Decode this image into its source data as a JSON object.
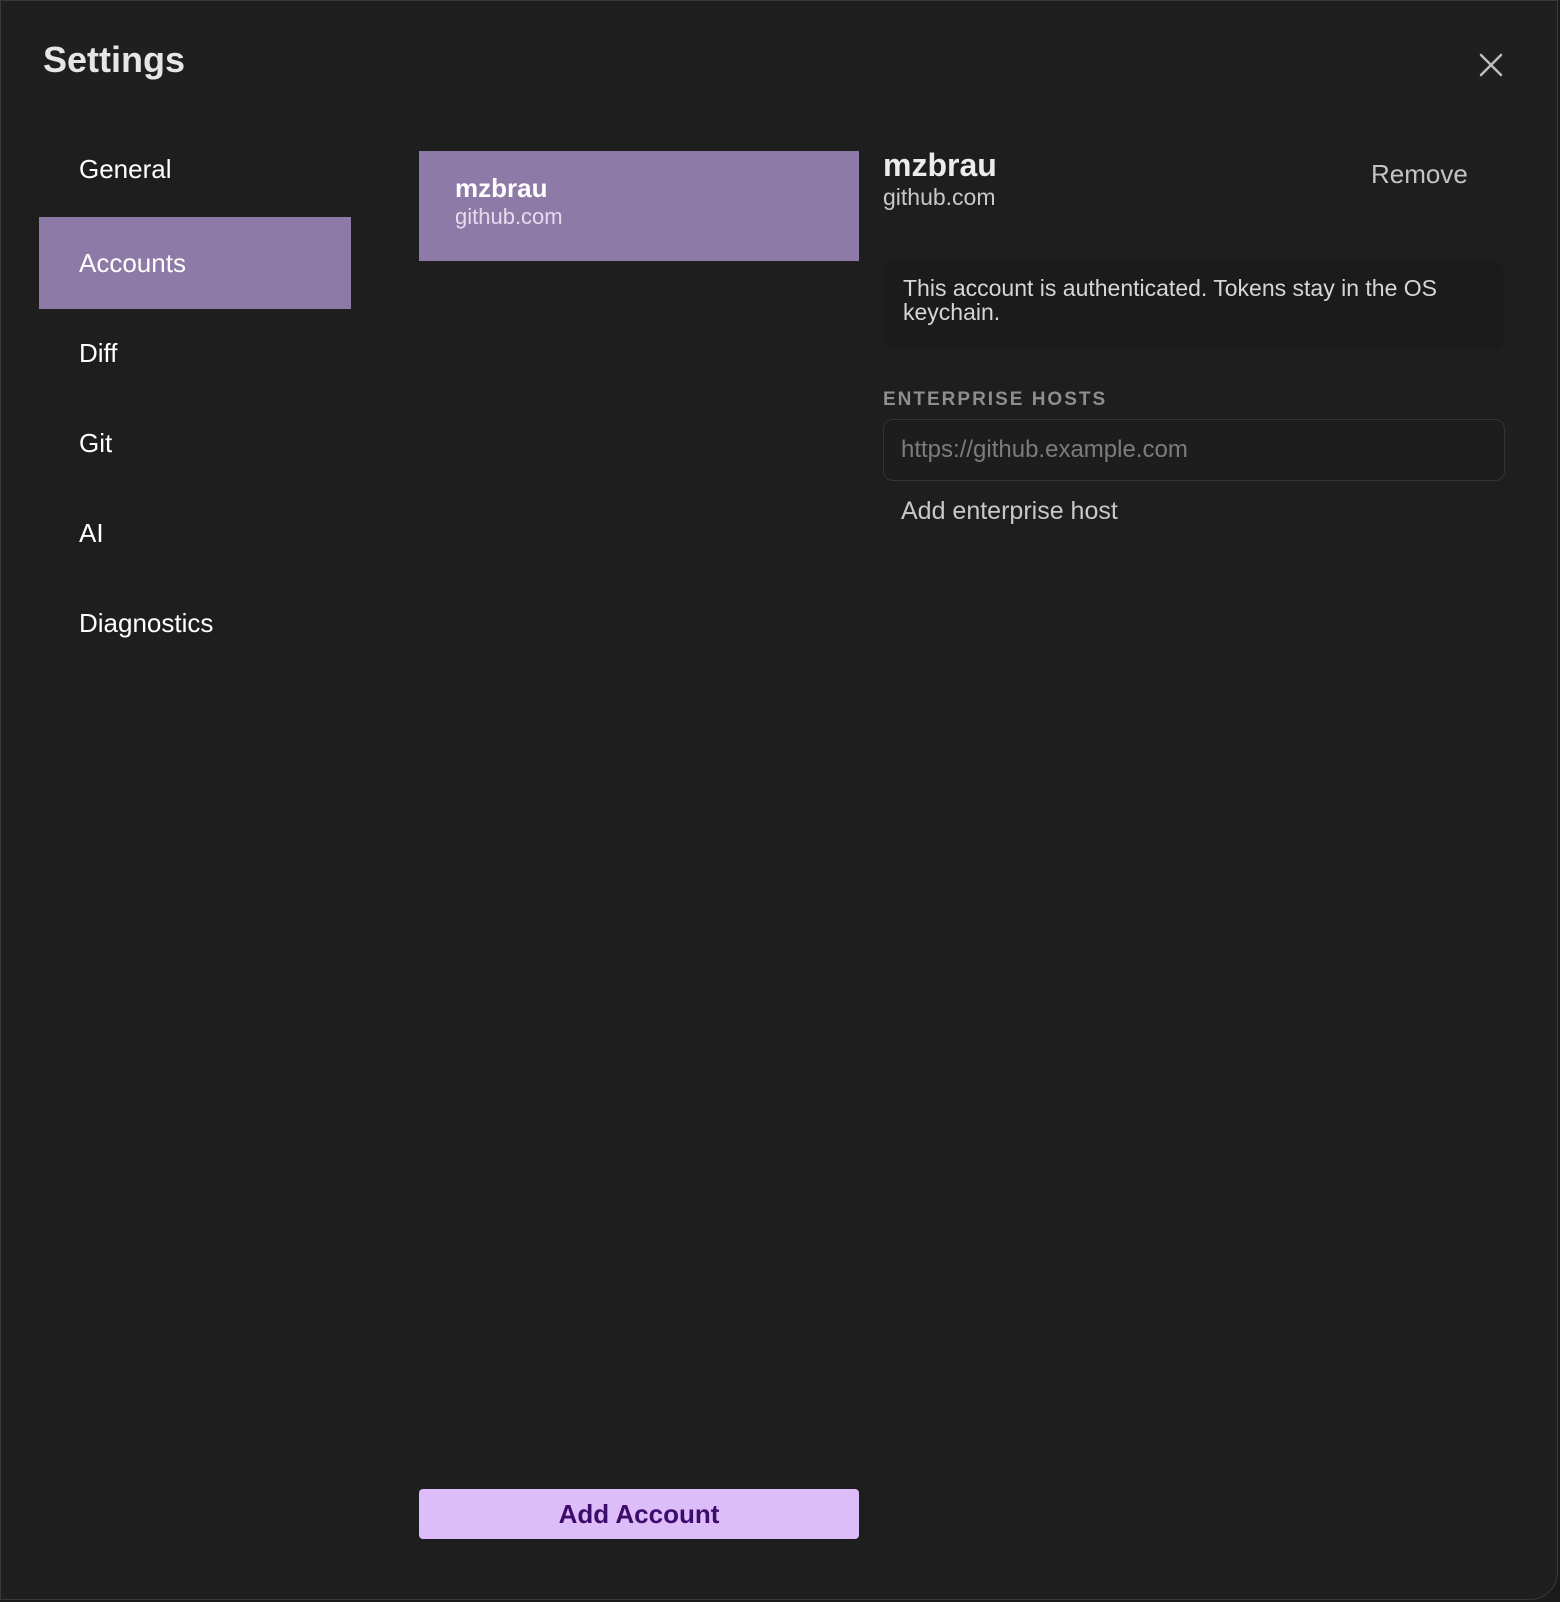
{
  "window": {
    "title": "Settings",
    "close_icon": "close-icon"
  },
  "sidebar": {
    "items": [
      {
        "label": "General",
        "active": false
      },
      {
        "label": "Accounts",
        "active": true
      },
      {
        "label": "Diff",
        "active": false
      },
      {
        "label": "Git",
        "active": false
      },
      {
        "label": "AI",
        "active": false
      },
      {
        "label": "Diagnostics",
        "active": false
      }
    ]
  },
  "accounts": {
    "list": [
      {
        "name": "mzbrau",
        "host": "github.com",
        "selected": true
      }
    ],
    "add_button_label": "Add Account"
  },
  "detail": {
    "name": "mzbrau",
    "host": "github.com",
    "remove_label": "Remove",
    "notice": "This account is authenticated. Tokens stay in the OS keychain.",
    "enterprise_hosts_label": "ENTERPRISE HOSTS",
    "host_input": {
      "value": "",
      "placeholder": "https://github.example.com"
    },
    "add_host_label": "Add enterprise host"
  },
  "colors": {
    "background": "#1f1f1f",
    "accent": "#8e7aa6",
    "button_bg": "#dcbdf9",
    "button_text": "#3d0b6a"
  }
}
